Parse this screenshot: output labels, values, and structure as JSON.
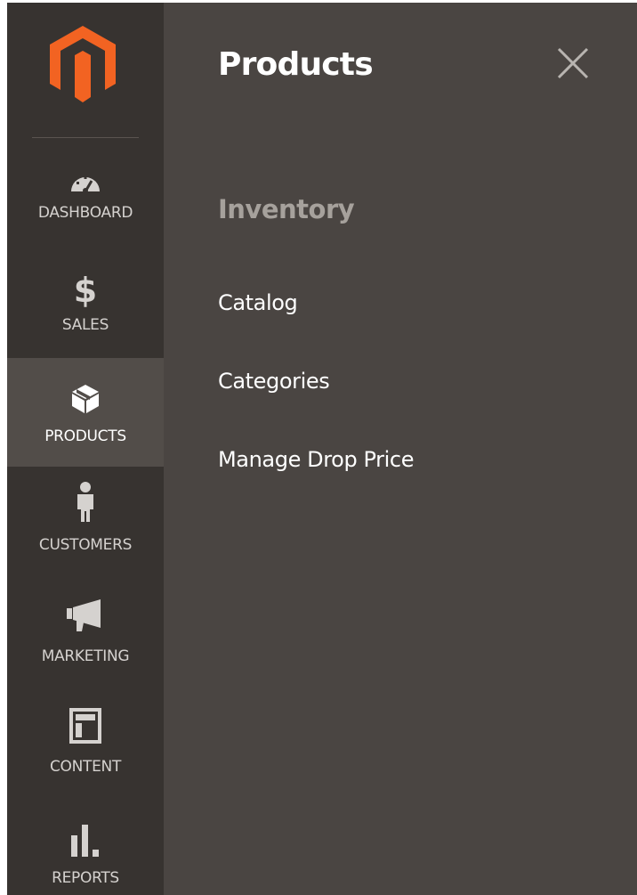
{
  "brand": {
    "logo_icon": "magento-logo-icon",
    "accent_color": "#f26322"
  },
  "sidebar": {
    "items": [
      {
        "label": "DASHBOARD",
        "icon": "speedometer-icon",
        "active": false
      },
      {
        "label": "SALES",
        "icon": "dollar-icon",
        "active": false
      },
      {
        "label": "PRODUCTS",
        "icon": "box-icon",
        "active": true
      },
      {
        "label": "CUSTOMERS",
        "icon": "person-icon",
        "active": false
      },
      {
        "label": "MARKETING",
        "icon": "megaphone-icon",
        "active": false
      },
      {
        "label": "CONTENT",
        "icon": "layout-icon",
        "active": false
      },
      {
        "label": "REPORTS",
        "icon": "bar-chart-icon",
        "active": false
      }
    ]
  },
  "panel": {
    "title": "Products",
    "close_icon": "close-icon",
    "section": {
      "title": "Inventory",
      "links": [
        "Catalog",
        "Categories",
        "Manage Drop Price"
      ]
    }
  },
  "colors": {
    "sidebar_bg": "#373330",
    "active_item_bg": "#524d49",
    "panel_bg": "#4a4542",
    "section_title": "#a6a19c",
    "text": "#ffffff"
  }
}
